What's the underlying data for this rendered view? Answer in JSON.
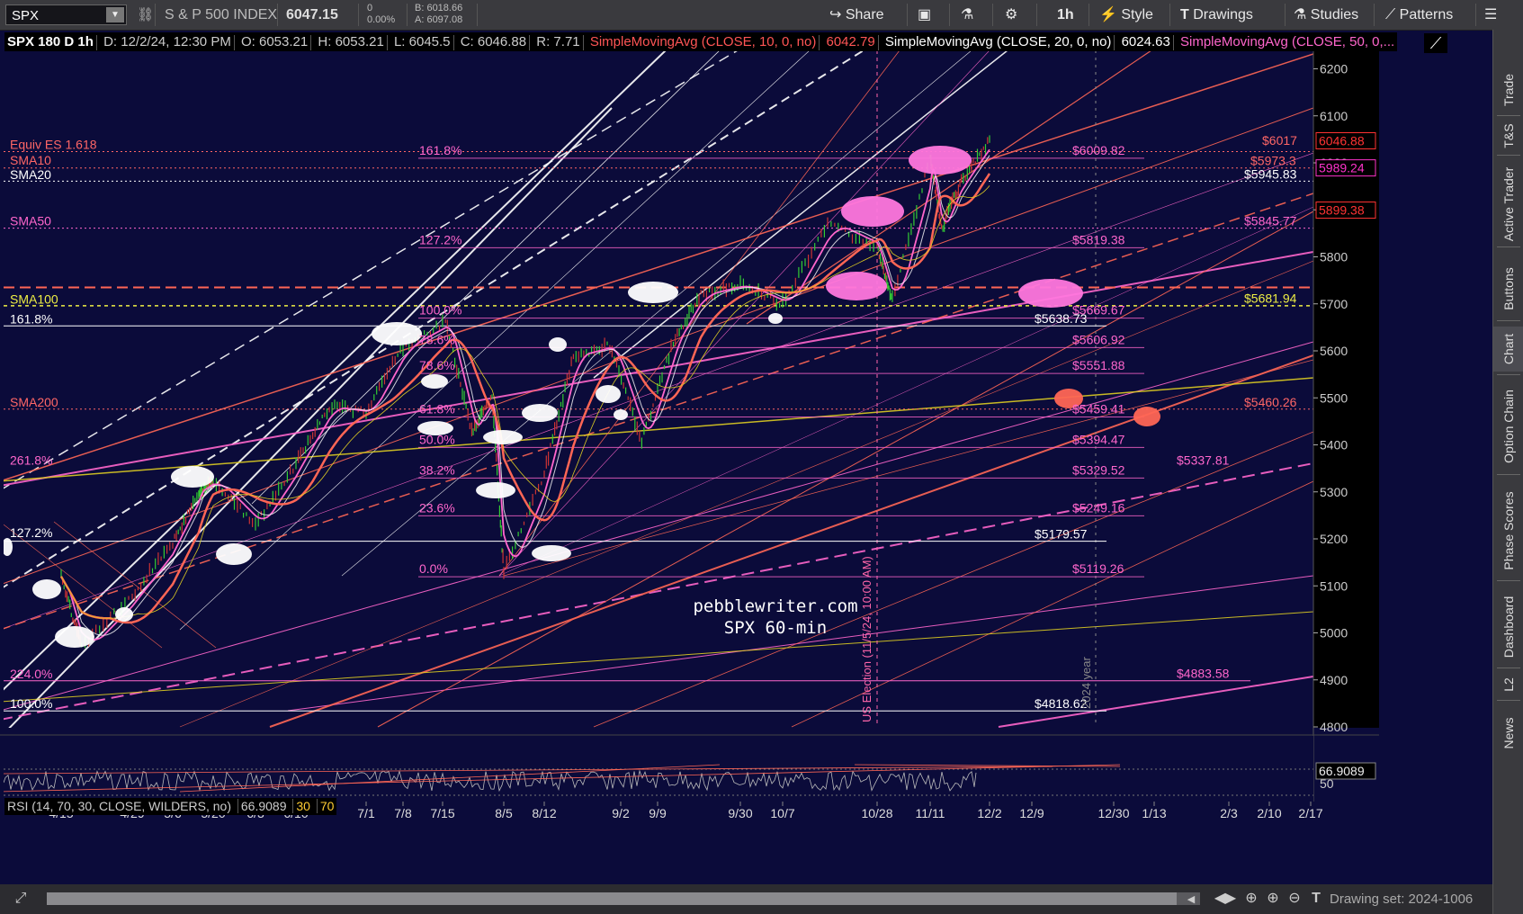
{
  "toolbar": {
    "symbol": "SPX",
    "description": "S & P 500 INDEX",
    "last": "6047.15",
    "change": "0",
    "change_pct": "0.00%",
    "bid": "B: 6018.66",
    "ask": "A: 6097.08",
    "share_label": "Share",
    "timeframe": "1h",
    "style_label": "Style",
    "drawings_label": "Drawings",
    "studies_label": "Studies",
    "patterns_label": "Patterns"
  },
  "legend": {
    "title": "SPX 180 D 1h",
    "date": "D: 12/2/24, 12:30 PM",
    "open": "O: 6053.21",
    "high": "H: 6053.21",
    "low": "L: 6045.5",
    "close": "C: 6046.88",
    "range": "R: 7.71",
    "sma10_label": "SimpleMovingAvg (CLOSE, 10, 0, no)",
    "sma10_value": "6042.79",
    "sma20_label": "SimpleMovingAvg (CLOSE, 20, 0, no)",
    "sma20_value": "6024.63",
    "sma50_label": "SimpleMovingAvg (CLOSE, 50, 0,..."
  },
  "rsi_legend": {
    "label": "RSI (14, 70, 30, CLOSE, WILDERS, no)",
    "value": "66.9089",
    "level_low": "30",
    "level_high": "70"
  },
  "sidebar": {
    "tabs": [
      "Trade",
      "T&S",
      "Active Trader",
      "Buttons",
      "Chart",
      "Option Chain",
      "Phase Scores",
      "Dashboard",
      "L2",
      "News"
    ],
    "active": "Chart"
  },
  "bottombar": {
    "drawing_set": "Drawing set: 2024-1006"
  },
  "watermark": {
    "line1": "pebblewriter.com",
    "line2": "SPX 60-min"
  },
  "annotations": {
    "election": "US Election (11/5/24, 10:00 AM)",
    "year": "2024 year"
  },
  "colors": {
    "background": "#0b0b3a",
    "pink": "#ff66cc",
    "orange": "#ff6655",
    "yellow": "#ddcc22",
    "white": "#ffffff",
    "candle_up": "#33cc33"
  },
  "chart_data": {
    "type": "line",
    "title": "SPX 180 D 1h",
    "ylim": [
      4800,
      6250
    ],
    "y_ticks": [
      4800,
      4900,
      5000,
      5100,
      5200,
      5300,
      5400,
      5500,
      5600,
      5700,
      5800,
      5900,
      6000,
      6100,
      6200
    ],
    "x_ticks": [
      "4/15",
      "4/29",
      "5/6",
      "5/20",
      "6/3",
      "6/10",
      "7/1",
      "7/8",
      "7/15",
      "8/5",
      "8/12",
      "9/2",
      "9/9",
      "9/30",
      "10/7",
      "10/28",
      "11/11",
      "12/2",
      "12/9",
      "12/30",
      "1/13",
      "2/3",
      "2/10",
      "2/17"
    ],
    "price_path": [
      [
        "4/15",
        5120
      ],
      [
        "4/19",
        4970
      ],
      [
        "4/29",
        5080
      ],
      [
        "5/6",
        5190
      ],
      [
        "5/15",
        5300
      ],
      [
        "5/20",
        5320
      ],
      [
        "6/3",
        5230
      ],
      [
        "6/10",
        5360
      ],
      [
        "6/20",
        5480
      ],
      [
        "7/1",
        5470
      ],
      [
        "7/8",
        5610
      ],
      [
        "7/16",
        5660
      ],
      [
        "7/25",
        5430
      ],
      [
        "8/1",
        5500
      ],
      [
        "8/5",
        5130
      ],
      [
        "8/12",
        5340
      ],
      [
        "8/20",
        5590
      ],
      [
        "8/30",
        5610
      ],
      [
        "9/6",
        5410
      ],
      [
        "9/13",
        5620
      ],
      [
        "9/20",
        5720
      ],
      [
        "9/30",
        5740
      ],
      [
        "10/7",
        5700
      ],
      [
        "10/17",
        5870
      ],
      [
        "10/28",
        5820
      ],
      [
        "11/1",
        5710
      ],
      [
        "11/11",
        6010
      ],
      [
        "11/15",
        5860
      ],
      [
        "11/22",
        5960
      ],
      [
        "12/2",
        6046.88
      ]
    ],
    "last_price": 6046.88,
    "fib_retracements": [
      {
        "label": "161.8%",
        "price": 6009.82
      },
      {
        "label": "127.2%",
        "price": 5819.38
      },
      {
        "label": "100.0%",
        "price": 5669.67
      },
      {
        "label": "78.6%",
        "price": 5606.92
      },
      {
        "label": "70.7%",
        "price": 5551.88
      },
      {
        "label": "61.8%",
        "price": 5459.41
      },
      {
        "label": "50.0%",
        "price": 5394.47
      },
      {
        "label": "38.2%",
        "price": 5329.52
      },
      {
        "label": "23.6%",
        "price": 5249.16
      },
      {
        "label": "0.0%",
        "price": 5119.26
      }
    ],
    "fib_labels_shown": [
      "161.8%",
      "127.2%",
      "100.0%",
      "78.6%",
      "78.6%",
      "61.8%",
      "50.0%",
      "38.2%",
      "23.6%",
      "0.0%"
    ],
    "fib_price_labels": [
      "$6009.82",
      "$5819.38",
      "$5669.67",
      "$5606.92",
      "$5551.88",
      "$5459.41",
      "$5394.47",
      "$5329.52",
      "$5249.16",
      "$5119.26"
    ],
    "left_labels": [
      {
        "label": "Equiv ES 1.618",
        "price": 6024,
        "color": "#ff6666"
      },
      {
        "label": "SMA10",
        "price": 5990,
        "color": "#ff6666"
      },
      {
        "label": "SMA20",
        "price": 5960,
        "color": "#ffffff"
      },
      {
        "label": "SMA50",
        "price": 5861,
        "color": "#ff66cc"
      },
      {
        "label": "SMA100",
        "price": 5695,
        "color": "#eeee44"
      },
      {
        "label": "161.8%",
        "price": 5653,
        "color": "#ffffff"
      },
      {
        "label": "SMA200",
        "price": 5476,
        "color": "#ff6666"
      },
      {
        "label": "261.8%",
        "price": 5352,
        "color": "#ff66cc"
      },
      {
        "label": "127.2%",
        "price": 5198,
        "color": "#ffffff"
      },
      {
        "label": "224.0%",
        "price": 4898,
        "color": "#ff66cc"
      },
      {
        "label": "100.0%",
        "price": 4834,
        "color": "#ffffff"
      }
    ],
    "right_labels": [
      {
        "label": "$6017",
        "price": 6033,
        "color": "#ff6666"
      },
      {
        "label": "$5973.3",
        "price": 5989,
        "color": "#ff6666"
      },
      {
        "label": "$5945.83",
        "price": 5961,
        "color": "#ffffff"
      },
      {
        "label": "$5845.77",
        "price": 5861,
        "color": "#ff66cc"
      },
      {
        "label": "$5681.94",
        "price": 5697,
        "color": "#eeee44"
      },
      {
        "label": "$5638.73",
        "price": 5654,
        "color": "#ffffff"
      },
      {
        "label": "$5460.26",
        "price": 5476,
        "color": "#ff6666"
      },
      {
        "label": "$5337.81",
        "price": 5352,
        "color": "#ff66cc"
      },
      {
        "label": "$5179.57",
        "price": 5195,
        "color": "#ffffff"
      },
      {
        "label": "$4883.58",
        "price": 4899,
        "color": "#ff66cc"
      },
      {
        "label": "$4818.62",
        "price": 4834,
        "color": "#ffffff"
      }
    ],
    "price_flags": [
      {
        "label": "6046.88",
        "price": 6046.88,
        "color": "#ff3333"
      },
      {
        "label": "5989.24",
        "price": 5989.24,
        "color": "#ff33cc"
      },
      {
        "label": "5899.38",
        "price": 5899.38,
        "color": "#ff3333"
      }
    ],
    "rsi": {
      "value": 66.9089,
      "levels": [
        30,
        70
      ],
      "tick_label": "50"
    }
  }
}
